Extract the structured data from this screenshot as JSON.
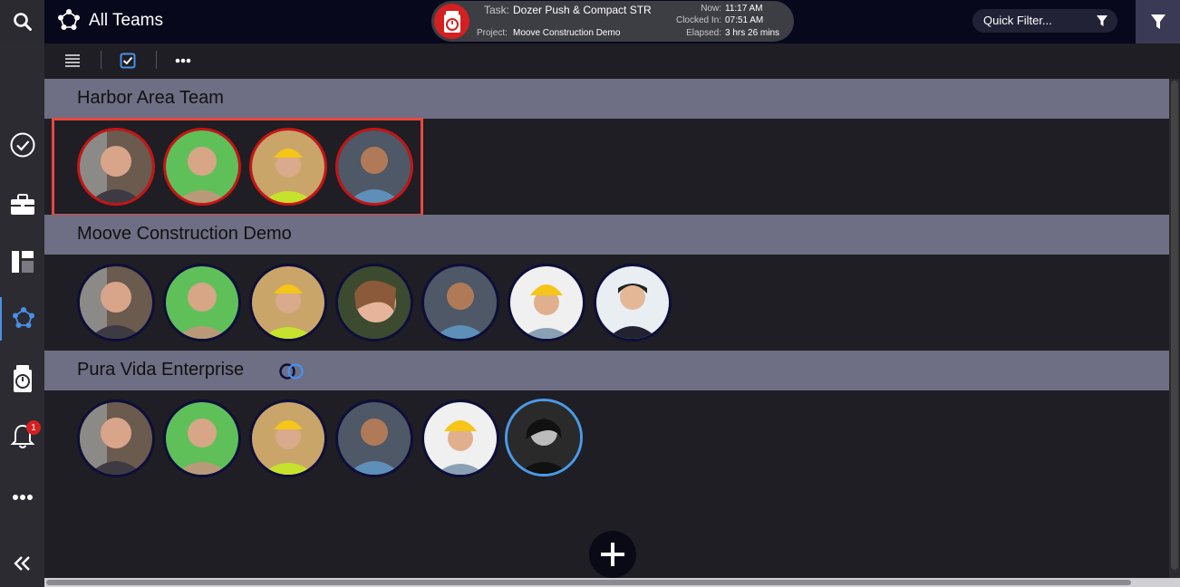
{
  "header": {
    "title": "All Teams",
    "timer": {
      "task_label": "Task:",
      "task_value": "Dozer Push & Compact STR",
      "project_label": "Project:",
      "project_value": "Moove Construction Demo",
      "now_label": "Now:",
      "now_value": "11:17 AM",
      "clocked_label": "Clocked In:",
      "clocked_value": "07:51 AM",
      "elapsed_label": "Elapsed:",
      "elapsed_value": "3 hrs 26 mins"
    },
    "quick_filter_placeholder": "Quick Filter..."
  },
  "sidebar": {
    "items": [
      {
        "icon": "check-circle-icon"
      },
      {
        "icon": "briefcase-icon"
      },
      {
        "icon": "layout-icon"
      },
      {
        "icon": "teams-icon",
        "active": true
      },
      {
        "icon": "timer-icon"
      },
      {
        "icon": "bell-icon",
        "badge": "1"
      },
      {
        "icon": "more-icon"
      },
      {
        "icon": "collapse-icon"
      }
    ]
  },
  "toolbar": {
    "items": [
      "list-view-icon",
      "select-icon",
      "more-icon"
    ]
  },
  "teams": [
    {
      "name": "Harbor Area Team",
      "members": 4
    },
    {
      "name": "Moove Construction Demo",
      "members": 7
    },
    {
      "name": "Pura Vida Enterprise",
      "members": 6
    }
  ],
  "colors": {
    "accent": "#4a8fe8",
    "alert": "#d42020",
    "header_band": "#6e6e84"
  }
}
